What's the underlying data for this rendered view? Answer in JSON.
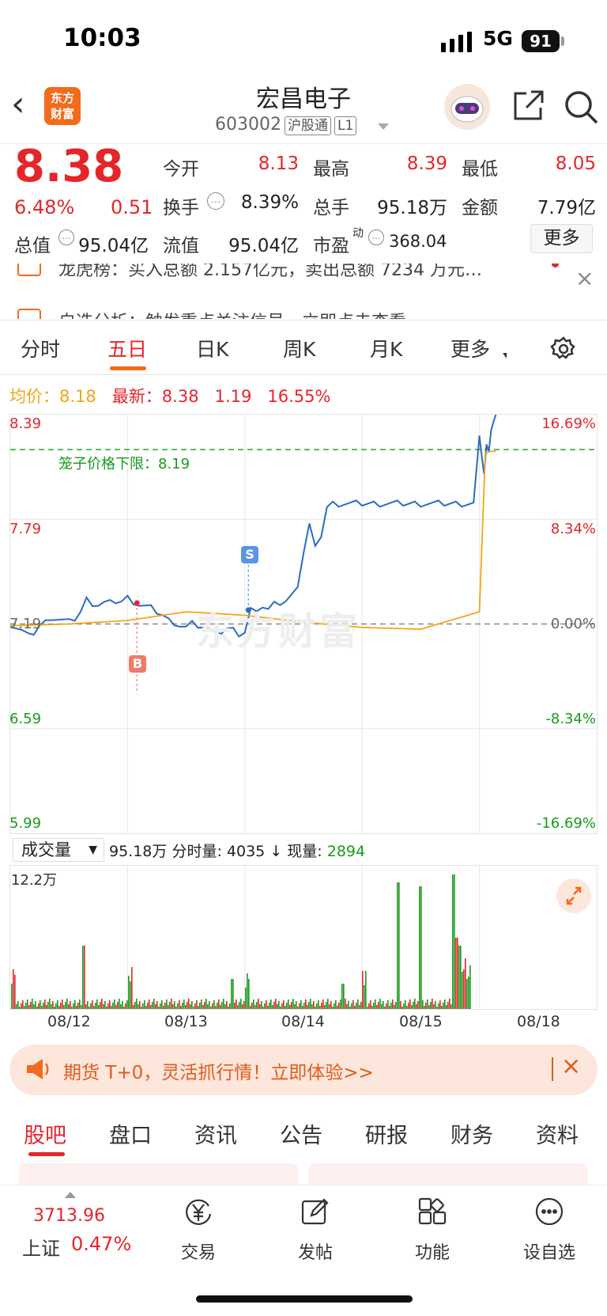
{
  "status_bar": {
    "time": "10:03",
    "network": "5G",
    "battery": "91"
  },
  "header": {
    "logo_line1": "东方",
    "logo_line2": "财富",
    "name": "宏昌电子",
    "code": "603002",
    "badge1": "沪股通",
    "badge2": "L1"
  },
  "quote": {
    "price": "8.38",
    "change_pct": "6.48%",
    "change": "0.51",
    "open_label": "今开",
    "open": "8.13",
    "high_label": "最高",
    "high": "8.39",
    "low_label": "最低",
    "low": "8.05",
    "turnover_label": "换手",
    "turnover": "8.39%",
    "vol_label": "总手",
    "vol": "95.18万",
    "amount_label": "金额",
    "amount": "7.79亿",
    "mcap_label": "总值",
    "mcap": "95.04亿",
    "float_label": "流值",
    "float": "95.04亿",
    "pe_label": "市盈",
    "pe_sup": "动",
    "pe": "368.04",
    "more": "更多"
  },
  "notices": [
    "龙虎榜：买入总额 2.157亿元，卖出总额 7234 万元…",
    "自选分析：触发重点关注信号，立即点击查看"
  ],
  "period_tabs": [
    "分时",
    "五日",
    "日K",
    "周K",
    "月K",
    "更多"
  ],
  "info_line": {
    "avg_label": "均价：",
    "avg": "8.18",
    "latest_label": "最新：",
    "latest": "8.38",
    "chg": "1.19",
    "chg_pct": "16.55%"
  },
  "chart_data": {
    "type": "line",
    "y_left": [
      "8.39",
      "7.79",
      "7.19",
      "6.59",
      "5.99"
    ],
    "y_right": [
      "16.69%",
      "8.34%",
      "0.00%",
      "-8.34%",
      "-16.69%"
    ],
    "ylim": [
      5.99,
      8.39
    ],
    "ref_price": 7.19,
    "cage_label": "笼子价格下限：8.19",
    "cage_price": 8.19,
    "markers": [
      "B",
      "S"
    ],
    "watermark": "东方财富",
    "series": [
      {
        "name": "最新",
        "color": "#2c6dbe",
        "x": [
          0,
          0.05,
          0.1,
          0.15,
          0.2,
          0.25,
          0.3,
          0.35,
          0.4,
          0.45,
          0.5,
          0.55,
          0.6,
          0.65,
          0.7,
          0.75,
          0.8,
          0.85,
          0.9,
          0.95,
          1.0,
          1.05,
          1.1,
          1.15,
          1.2,
          1.25,
          1.3,
          1.35,
          1.4,
          1.45,
          1.5,
          1.55,
          1.6,
          1.65,
          1.7,
          1.75,
          1.8,
          1.85,
          1.9,
          1.95,
          2.0,
          2.05,
          2.1,
          2.15,
          2.2,
          2.25,
          2.3,
          2.35,
          2.4,
          2.45,
          2.5,
          2.55,
          2.6,
          2.65,
          2.7,
          2.75,
          2.8,
          2.85,
          2.9,
          2.95,
          3.0,
          3.05,
          3.1,
          3.15,
          3.2,
          3.25,
          3.3,
          3.35,
          3.4,
          3.45,
          3.5,
          3.55,
          3.6,
          3.65,
          3.7,
          3.75,
          3.8,
          3.85,
          3.9,
          3.95,
          4.0,
          4.02,
          4.04,
          4.06,
          4.08,
          4.1,
          4.12,
          4.14
        ],
        "y": [
          7.19,
          7.17,
          7.15,
          7.12,
          7.14,
          7.18,
          7.2,
          7.23,
          7.22,
          7.21,
          7.2,
          7.22,
          7.26,
          7.33,
          7.31,
          7.3,
          7.31,
          7.31,
          7.32,
          7.32,
          7.34,
          7.32,
          7.3,
          7.29,
          7.28,
          7.26,
          7.24,
          7.21,
          7.2,
          7.18,
          7.17,
          7.19,
          7.18,
          7.17,
          7.15,
          7.16,
          7.14,
          7.16,
          7.15,
          7.13,
          7.14,
          7.27,
          7.28,
          7.29,
          7.27,
          7.3,
          7.31,
          7.32,
          7.35,
          7.42,
          7.6,
          7.76,
          7.62,
          7.7,
          7.86,
          7.88,
          7.88,
          7.88,
          7.88,
          7.88,
          7.88,
          7.88,
          7.88,
          7.88,
          7.88,
          7.88,
          7.88,
          7.88,
          7.88,
          7.88,
          7.88,
          7.88,
          7.88,
          7.88,
          7.88,
          7.88,
          7.88,
          7.88,
          7.88,
          7.88,
          8.27,
          8.15,
          8.05,
          8.22,
          8.18,
          8.3,
          8.35,
          8.39
        ]
      },
      {
        "name": "均价",
        "color": "#f3a418",
        "x": [
          0,
          0.5,
          1.0,
          1.5,
          2.0,
          2.5,
          3.0,
          3.5,
          4.0,
          4.05,
          4.1,
          4.14
        ],
        "y": [
          7.18,
          7.19,
          7.21,
          7.26,
          7.24,
          7.2,
          7.17,
          7.16,
          7.26,
          8.17,
          8.18,
          8.18
        ]
      }
    ],
    "x_labels": [
      "08/12",
      "08/13",
      "08/14",
      "08/15",
      "08/18"
    ]
  },
  "volume": {
    "selector": "成交量",
    "total": "95.18万",
    "fen_label": "分时量:",
    "fen_val": "4035",
    "arrow": "↓",
    "cur_label": "现量:",
    "cur_val": "2894",
    "ymax": "12.2万"
  },
  "ad": {
    "text": "期货 T+0，灵活抓行情！立即体验>>"
  },
  "bottom_tabs": [
    "股吧",
    "盘口",
    "资讯",
    "公告",
    "研报",
    "财务",
    "资料"
  ],
  "index": {
    "value": "3713.96",
    "name": "上证",
    "pct": "0.47%"
  },
  "nav": [
    "交易",
    "发帖",
    "功能",
    "设自选"
  ]
}
